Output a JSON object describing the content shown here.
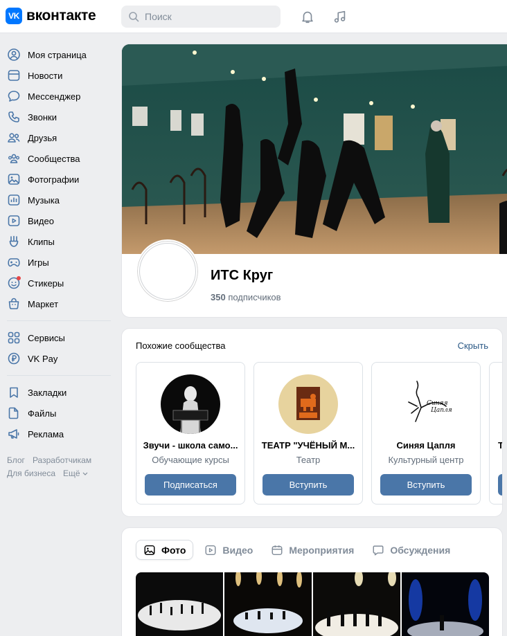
{
  "header": {
    "logo_text": "вконтакте",
    "logo_mark": "VK",
    "search_placeholder": "Поиск",
    "icons": [
      "bell-icon",
      "music-icon"
    ]
  },
  "sidebar": {
    "items": [
      {
        "label": "Моя страница",
        "icon": "user-circle-icon"
      },
      {
        "label": "Новости",
        "icon": "news-icon"
      },
      {
        "label": "Мессенджер",
        "icon": "chat-bubble-icon"
      },
      {
        "label": "Звонки",
        "icon": "phone-icon"
      },
      {
        "label": "Друзья",
        "icon": "friends-icon"
      },
      {
        "label": "Сообщества",
        "icon": "communities-icon"
      },
      {
        "label": "Фотографии",
        "icon": "photo-icon"
      },
      {
        "label": "Музыка",
        "icon": "music-bars-icon"
      },
      {
        "label": "Видео",
        "icon": "video-icon"
      },
      {
        "label": "Клипы",
        "icon": "clips-icon"
      },
      {
        "label": "Игры",
        "icon": "gamepad-icon"
      },
      {
        "label": "Стикеры",
        "icon": "sticker-icon"
      },
      {
        "label": "Маркет",
        "icon": "market-bag-icon"
      }
    ],
    "items2": [
      {
        "label": "Сервисы",
        "icon": "services-grid-icon"
      },
      {
        "label": "VK Pay",
        "icon": "ruble-icon"
      }
    ],
    "items3": [
      {
        "label": "Закладки",
        "icon": "bookmark-icon"
      },
      {
        "label": "Файлы",
        "icon": "file-icon"
      },
      {
        "label": "Реклама",
        "icon": "megaphone-icon"
      }
    ],
    "footer": [
      "Блог",
      "Разработчикам",
      "Для бизнеса",
      "Ещё"
    ]
  },
  "profile": {
    "name": "ИТС Круг",
    "subscribers_count": "350",
    "subscribers_label": "подписчиков"
  },
  "similar": {
    "title": "Похожие сообщества",
    "hide_label": "Скрыть",
    "items": [
      {
        "name": "Звучи - школа само...",
        "category": "Обучающие курсы",
        "button": "Подписаться"
      },
      {
        "name": "ТЕАТР \"УЧЁНЫЙ М...",
        "category": "Театр",
        "button": "Вступить"
      },
      {
        "name": "Синяя Цапля",
        "category": "Культурный центр",
        "button": "Вступить"
      },
      {
        "name": "Т",
        "category": "",
        "button": ""
      }
    ],
    "logo_text": "Синяя Цапля"
  },
  "media": {
    "tabs": [
      {
        "label": "Фото",
        "icon": "photo-icon",
        "active": true
      },
      {
        "label": "Видео",
        "icon": "video-icon",
        "active": false
      },
      {
        "label": "Мероприятия",
        "icon": "calendar-icon",
        "active": false
      },
      {
        "label": "Обсуждения",
        "icon": "discussion-icon",
        "active": false
      }
    ]
  },
  "colors": {
    "accent": "#0077ff",
    "button": "#4a76a8",
    "link": "#2a5885",
    "background": "#edeef0"
  }
}
